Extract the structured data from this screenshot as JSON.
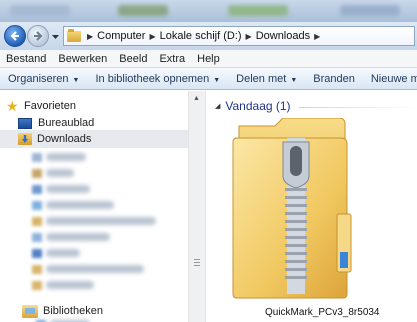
{
  "address": {
    "crumbs": [
      "Computer",
      "Lokale schijf (D:)",
      "Downloads"
    ]
  },
  "menu": [
    "Bestand",
    "Bewerken",
    "Beeld",
    "Extra",
    "Help"
  ],
  "commands": {
    "organize": "Organiseren",
    "include": "In bibliotheek opnemen",
    "share": "Delen met",
    "burn": "Branden",
    "new_folder": "Nieuwe map"
  },
  "nav": {
    "favorites": "Favorieten",
    "desktop": "Bureaublad",
    "downloads": "Downloads",
    "libraries": "Bibliotheken"
  },
  "content": {
    "group": "Vandaag (1)",
    "file": "QuickMark_PCv3_8r5034"
  },
  "icons": {
    "back": "back-arrow-icon",
    "forward": "forward-arrow-icon",
    "favorites": "star-icon",
    "file": "zip-folder-icon"
  },
  "colors": {
    "accent": "#1e3287",
    "selection": "#e6e9ee"
  }
}
